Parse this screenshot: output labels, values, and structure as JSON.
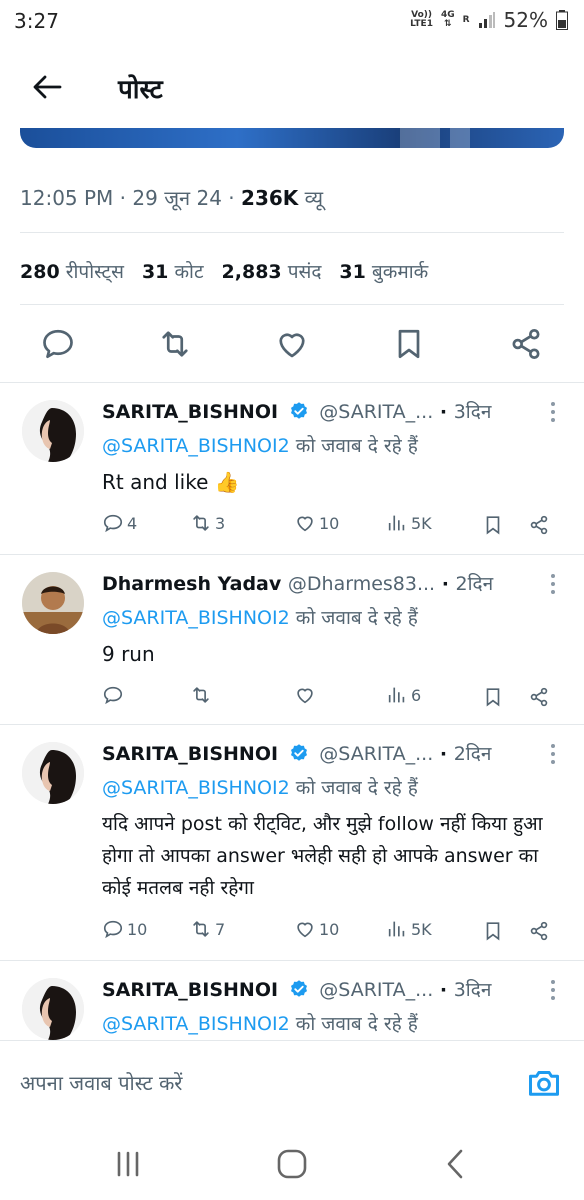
{
  "status_bar": {
    "time": "3:27",
    "volte": "Vo))",
    "lte": "LTE1",
    "net": "4G",
    "roam": "R",
    "battery": "52%"
  },
  "header": {
    "title": "पोस्ट"
  },
  "post": {
    "time": "12:05 PM",
    "date": "29 जून 24",
    "views_count": "236K",
    "views_label": "व्यू",
    "reposts_count": "280",
    "reposts_label": "रीपोस्ट्स",
    "quotes_count": "31",
    "quotes_label": "कोट",
    "likes_count": "2,883",
    "likes_label": "पसंद",
    "bookmarks_count": "31",
    "bookmarks_label": "बुकमार्क"
  },
  "replies": [
    {
      "name": "SARITA_BISHNOI",
      "verified": true,
      "handle": "@SARITA_...",
      "age": "3दिन",
      "to_mention": "@SARITA_BISHNOI2",
      "to_text": "को जवाब दे रहे हैं",
      "body": "Rt and like 👍",
      "replies": "4",
      "reposts": "3",
      "likes": "10",
      "views": "5K"
    },
    {
      "name": "Dharmesh Yadav",
      "verified": false,
      "handle": "@Dharmes83...",
      "age": "2दिन",
      "to_mention": "@SARITA_BISHNOI2",
      "to_text": "को जवाब दे रहे हैं",
      "body": "9 run",
      "replies": "",
      "reposts": "",
      "likes": "",
      "views": "6"
    },
    {
      "name": "SARITA_BISHNOI",
      "verified": true,
      "handle": "@SARITA_...",
      "age": "2दिन",
      "to_mention": "@SARITA_BISHNOI2",
      "to_text": "को जवाब दे रहे हैं",
      "body": "यदि आपने post को रीट्विट, और मुझे follow नहीं किया हुआ होगा तो आपका answer भलेही सही हो आपके answer का कोई मतलब नही रहेगा",
      "replies": "10",
      "reposts": "7",
      "likes": "10",
      "views": "5K"
    },
    {
      "name": "SARITA_BISHNOI",
      "verified": true,
      "handle": "@SARITA_...",
      "age": "3दिन",
      "to_mention": "@SARITA_BISHNOI2",
      "to_text": "को जवाब दे रहे हैं"
    }
  ],
  "compose": {
    "placeholder": "अपना जवाब पोस्ट करें"
  },
  "colors": {
    "accent": "#1d9bf0",
    "text": "#0f1419",
    "muted": "#536471"
  }
}
